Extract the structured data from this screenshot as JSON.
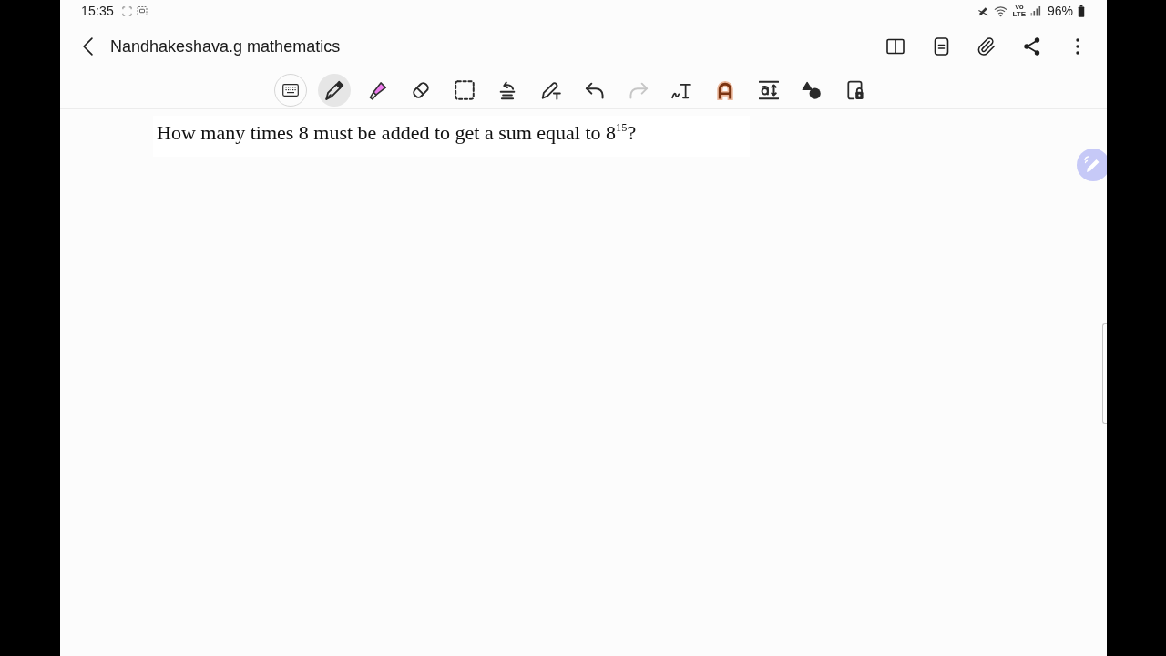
{
  "status_bar": {
    "time": "15:35",
    "network_labels": [
      "Vo",
      "LTE"
    ],
    "battery": "96%"
  },
  "app_bar": {
    "title": "Nandhakeshava.g mathematics"
  },
  "toolbar": {
    "tools": [
      {
        "kind": "keyboard",
        "selected": false,
        "disabled": false
      },
      {
        "kind": "pen",
        "selected": true,
        "disabled": false
      },
      {
        "kind": "highlighter",
        "selected": false,
        "disabled": false
      },
      {
        "kind": "eraser",
        "selected": false,
        "disabled": false
      },
      {
        "kind": "selection",
        "selected": false,
        "disabled": false
      },
      {
        "kind": "spacing",
        "selected": false,
        "disabled": false
      },
      {
        "kind": "pen_to_text",
        "selected": false,
        "disabled": false
      },
      {
        "kind": "undo",
        "selected": false,
        "disabled": false
      },
      {
        "kind": "redo",
        "selected": false,
        "disabled": true
      },
      {
        "kind": "handwriting",
        "selected": false,
        "disabled": false
      },
      {
        "kind": "text_color",
        "selected": false,
        "disabled": false
      },
      {
        "kind": "text_size",
        "selected": false,
        "disabled": false
      },
      {
        "kind": "shapes",
        "selected": false,
        "disabled": false
      },
      {
        "kind": "lock",
        "selected": false,
        "disabled": false
      }
    ]
  },
  "note": {
    "text": "How many times 8 must be added to get a sum equal to 8$^{15}$?"
  }
}
